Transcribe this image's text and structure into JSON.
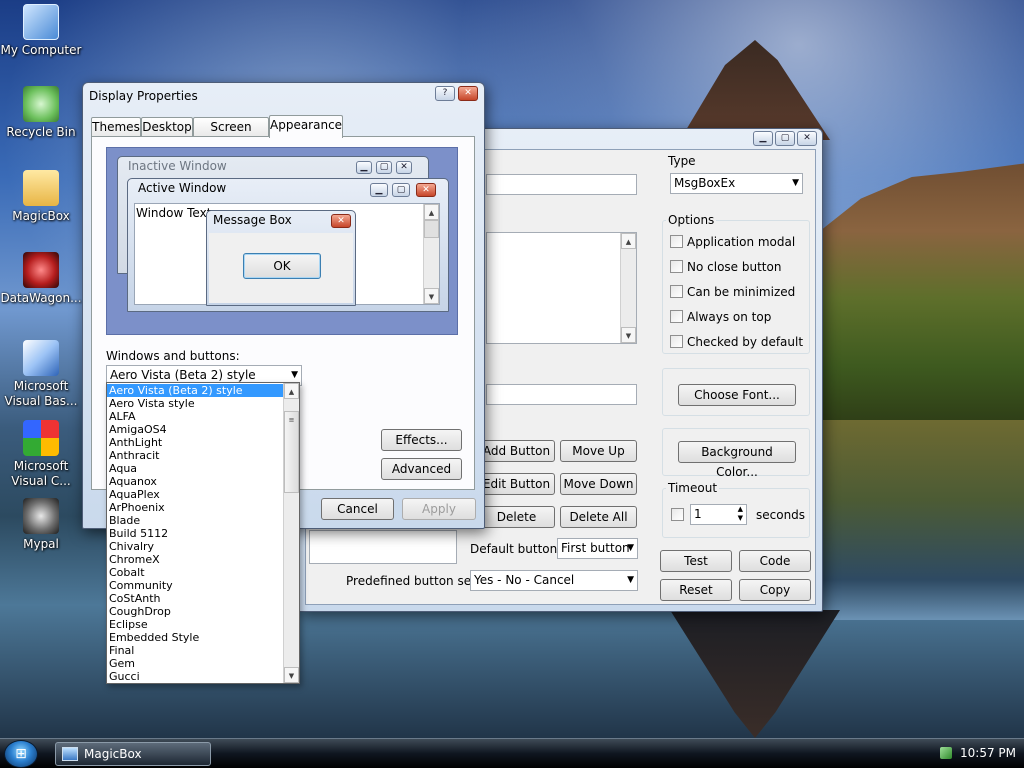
{
  "desktop": {
    "icons": [
      {
        "label": "My Computer"
      },
      {
        "label": "Recycle Bin"
      },
      {
        "label": "MagicBox"
      },
      {
        "label": "DataWagon..."
      },
      {
        "label": "Microsoft Visual Bas..."
      },
      {
        "label": "Microsoft Visual C..."
      },
      {
        "label": "Mypal"
      }
    ]
  },
  "magicbox": {
    "type_label": "Type",
    "type_value": "MsgBoxEx",
    "options_label": "Options",
    "options": [
      "Application modal",
      "No close button",
      "Can be minimized",
      "Always on top",
      "Checked by default"
    ],
    "choose_font": "Choose Font...",
    "background_color": "Background Color...",
    "add_button": "Add Button",
    "move_up": "Move Up",
    "edit_button": "Edit Button",
    "move_down": "Move Down",
    "delete": "Delete",
    "delete_all": "Delete All",
    "timeout_label": "Timeout",
    "timeout_value": "1",
    "seconds": "seconds",
    "default_button_label": "Default button:",
    "default_button_value": "First button",
    "predefined_label": "Predefined button sets:",
    "predefined_value": "Yes - No - Cancel",
    "test": "Test",
    "code": "Code",
    "reset": "Reset",
    "copy": "Copy"
  },
  "display_properties": {
    "title": "Display Properties",
    "help": "?",
    "close": "✕",
    "tabs": [
      "Themes",
      "Desktop",
      "Screen Saver",
      "Appearance"
    ],
    "preview": {
      "inactive_window": "Inactive Window",
      "active_window": "Active Window",
      "window_text": "Window Text",
      "message_box": "Message Box",
      "ok": "OK"
    },
    "windows_and_buttons_label": "Windows and buttons:",
    "windows_and_buttons_value": "Aero Vista (Beta 2) style",
    "effects": "Effects...",
    "advanced": "Advanced",
    "cancel": "Cancel",
    "apply": "Apply",
    "style_options": [
      "Aero Vista (Beta 2) style",
      "Aero Vista style",
      "ALFA",
      "AmigaOS4",
      "AnthLight",
      "Anthracit",
      "Aqua",
      "Aquanox",
      "AquaPlex",
      "ArPhoenix",
      "Blade",
      "Build 5112",
      "Chivalry",
      "ChromeX",
      "Cobalt",
      "Community",
      "CoStAnth",
      "CoughDrop",
      "Eclipse",
      "Embedded Style",
      "Final",
      "Gem",
      "Gucci"
    ]
  },
  "taskbar": {
    "start": "⊞",
    "task_label": "MagicBox",
    "clock": "10:57 PM"
  }
}
